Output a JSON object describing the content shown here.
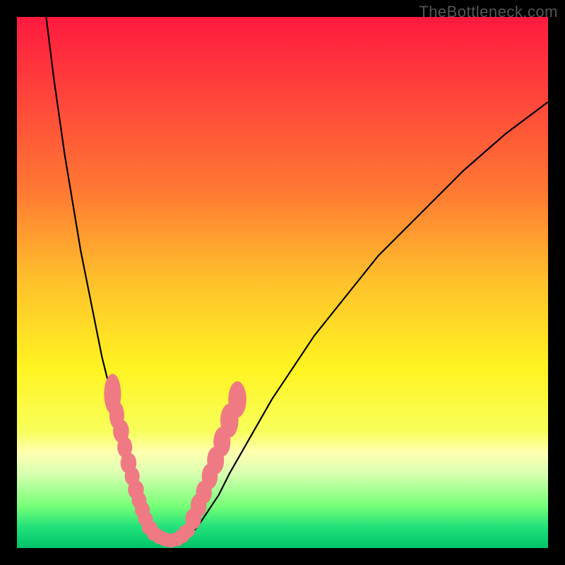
{
  "watermark": "TheBottleneck.com",
  "chart_data": {
    "type": "line",
    "title": "",
    "xlabel": "",
    "ylabel": "",
    "xlim": [
      0,
      100
    ],
    "ylim": [
      0,
      100
    ],
    "gradient_stops": [
      {
        "offset": 0,
        "color": "#ff1a3f"
      },
      {
        "offset": 0.17,
        "color": "#ff4a3a"
      },
      {
        "offset": 0.33,
        "color": "#ff7a33"
      },
      {
        "offset": 0.5,
        "color": "#ffc22b"
      },
      {
        "offset": 0.66,
        "color": "#fff321"
      },
      {
        "offset": 0.78,
        "color": "#f8ff5a"
      },
      {
        "offset": 0.82,
        "color": "#ffffb0"
      },
      {
        "offset": 0.86,
        "color": "#d8ffb0"
      },
      {
        "offset": 0.92,
        "color": "#78ff78"
      },
      {
        "offset": 0.96,
        "color": "#22e27a"
      },
      {
        "offset": 1.0,
        "color": "#00c46a"
      }
    ],
    "series": [
      {
        "name": "bottleneck-curve",
        "color": "#000000",
        "x": [
          5.5,
          6,
          7,
          8,
          9,
          10,
          11,
          12,
          13,
          14,
          15,
          16,
          17,
          18,
          19,
          20,
          21,
          22,
          23,
          24,
          25,
          26,
          27,
          28,
          30,
          32,
          34,
          36,
          38,
          40,
          44,
          48,
          52,
          56,
          60,
          64,
          68,
          72,
          76,
          80,
          84,
          88,
          92,
          96,
          100
        ],
        "y": [
          100,
          96,
          88,
          81,
          74,
          68,
          62,
          56,
          51,
          46,
          41,
          36,
          32,
          28,
          24,
          20,
          16,
          13,
          10,
          7,
          5,
          3,
          2,
          1.2,
          1,
          2,
          4,
          7,
          10,
          14,
          21,
          28,
          34,
          40,
          45,
          50,
          55,
          59,
          63,
          67,
          71,
          74.5,
          78,
          81,
          84
        ]
      }
    ],
    "markers": {
      "color": "#ef7a84",
      "groups": [
        {
          "name": "left-arm",
          "points": [
            {
              "x": 18.0,
              "y": 29.0,
              "rx": 1.6,
              "ry": 3.8
            },
            {
              "x": 18.8,
              "y": 25.0,
              "rx": 1.4,
              "ry": 2.6
            },
            {
              "x": 19.6,
              "y": 22.0,
              "rx": 1.5,
              "ry": 2.2
            },
            {
              "x": 20.3,
              "y": 19.0,
              "rx": 1.4,
              "ry": 2.0
            },
            {
              "x": 21.0,
              "y": 16.0,
              "rx": 1.5,
              "ry": 2.0
            },
            {
              "x": 21.7,
              "y": 13.5,
              "rx": 1.4,
              "ry": 1.8
            },
            {
              "x": 22.4,
              "y": 11.0,
              "rx": 1.5,
              "ry": 1.8
            },
            {
              "x": 23.0,
              "y": 9.0,
              "rx": 1.4,
              "ry": 1.6
            },
            {
              "x": 23.6,
              "y": 7.2,
              "rx": 1.4,
              "ry": 1.6
            },
            {
              "x": 24.2,
              "y": 5.5,
              "rx": 1.4,
              "ry": 1.4
            }
          ]
        },
        {
          "name": "bottom",
          "points": [
            {
              "x": 25.0,
              "y": 3.8,
              "rx": 1.5,
              "ry": 1.4
            },
            {
              "x": 26.0,
              "y": 2.6,
              "rx": 1.5,
              "ry": 1.3
            },
            {
              "x": 27.0,
              "y": 2.0,
              "rx": 1.5,
              "ry": 1.3
            },
            {
              "x": 28.0,
              "y": 1.6,
              "rx": 1.5,
              "ry": 1.3
            },
            {
              "x": 29.0,
              "y": 1.4,
              "rx": 1.5,
              "ry": 1.3
            },
            {
              "x": 30.0,
              "y": 1.6,
              "rx": 1.5,
              "ry": 1.3
            },
            {
              "x": 31.0,
              "y": 2.2,
              "rx": 1.5,
              "ry": 1.3
            },
            {
              "x": 32.0,
              "y": 3.2,
              "rx": 1.5,
              "ry": 1.3
            }
          ]
        },
        {
          "name": "right-arm",
          "points": [
            {
              "x": 33.2,
              "y": 5.5,
              "rx": 1.5,
              "ry": 2.0
            },
            {
              "x": 34.2,
              "y": 8.0,
              "rx": 1.5,
              "ry": 2.2
            },
            {
              "x": 35.2,
              "y": 10.5,
              "rx": 1.5,
              "ry": 2.2
            },
            {
              "x": 36.3,
              "y": 13.5,
              "rx": 1.5,
              "ry": 2.4
            },
            {
              "x": 37.4,
              "y": 16.5,
              "rx": 1.6,
              "ry": 2.6
            },
            {
              "x": 38.6,
              "y": 20.0,
              "rx": 1.6,
              "ry": 2.8
            },
            {
              "x": 40.0,
              "y": 24.0,
              "rx": 1.7,
              "ry": 3.2
            },
            {
              "x": 41.5,
              "y": 28.0,
              "rx": 1.7,
              "ry": 3.4
            }
          ]
        }
      ]
    }
  }
}
